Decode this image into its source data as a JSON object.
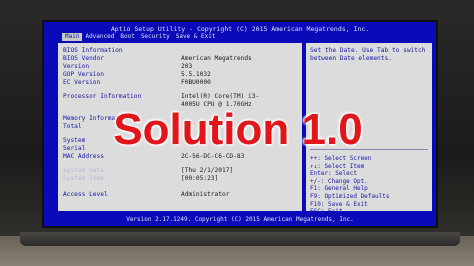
{
  "bios": {
    "title": "Aptio Setup Utility - Copyright (C) 2015 American Megatrends, Inc.",
    "menu": [
      {
        "label": "Main",
        "active": true
      },
      {
        "label": "Advanced",
        "active": false
      },
      {
        "label": "Boot",
        "active": false
      },
      {
        "label": "Security",
        "active": false
      },
      {
        "label": "Save & Exit",
        "active": false
      }
    ],
    "rows": [
      {
        "label": "BIOS Information",
        "value": ""
      },
      {
        "label": "BIOS Vendor",
        "value": "American Megatrends"
      },
      {
        "label": "Version",
        "value": "203"
      },
      {
        "label": "GOP Version",
        "value": "5.5.1032"
      },
      {
        "label": "EC Version",
        "value": "F0BU0000"
      },
      {
        "label": "Processor Information",
        "value": "Intel(R) Core(TM) i3-"
      },
      {
        "label": "",
        "value": "4005U CPU @ 1.70GHz"
      },
      {
        "label": "Memory Information",
        "value": ""
      },
      {
        "label": "Total",
        "value": ""
      },
      {
        "label": "System",
        "value": ""
      },
      {
        "label": "Serial",
        "value": ""
      },
      {
        "label": "MAC Address",
        "value": "2C-56-DC-C6-CD-83"
      },
      {
        "label": "System Date",
        "value": "[Thu 2/1/2017]"
      },
      {
        "label": "System Time",
        "value": "[00:05:23]"
      },
      {
        "label": "Access Level",
        "value": "Administrator"
      }
    ],
    "help_text": "Set the Date. Use Tab to switch between Date elements.",
    "keys": [
      "++: Select Screen",
      "↑↓: Select Item",
      "Enter: Select",
      "+/-: Change Opt.",
      "F1: General Help",
      "F9: Optimized Defaults",
      "F10: Save & Exit",
      "ESC: Exit"
    ],
    "footer": "Version 2.17.1249. Copyright (C) 2015 American Megatrends, Inc."
  },
  "overlay": {
    "text": "Solution 1.0"
  }
}
